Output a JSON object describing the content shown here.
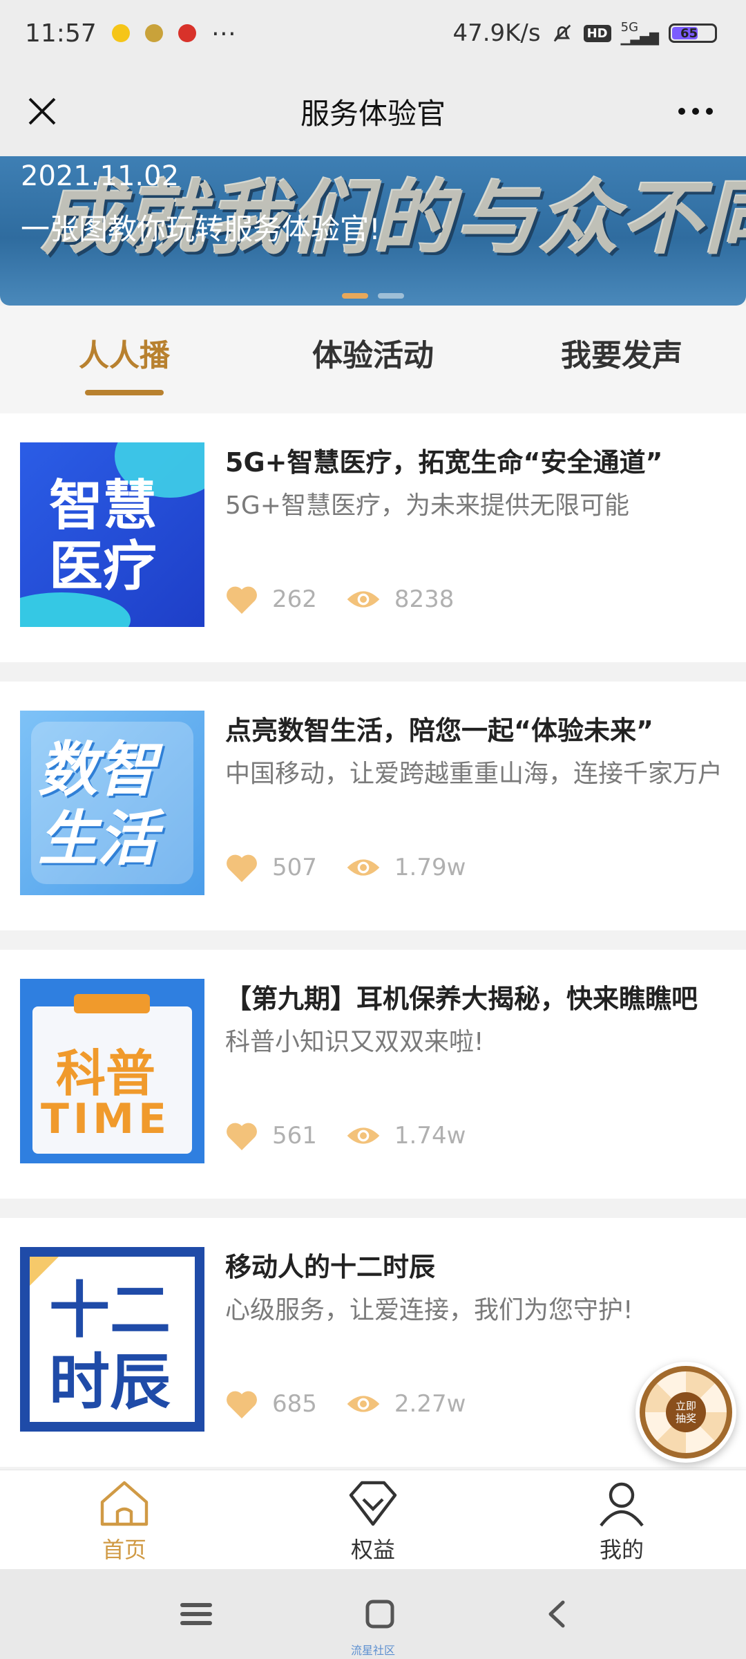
{
  "status_bar": {
    "time": "11:57",
    "more_icon": "⋯",
    "network_speed": "47.9K/s",
    "network_type": "5G",
    "hd_label": "HD",
    "battery": "65"
  },
  "title_bar": {
    "title": "服务体验官"
  },
  "banner": {
    "art_text": "成就我们的与众不同",
    "date": "2021.11.02",
    "caption": "一张图教你玩转服务体验官!"
  },
  "tabs": [
    {
      "label": "人人播",
      "active": true
    },
    {
      "label": "体验活动",
      "active": false
    },
    {
      "label": "我要发声",
      "active": false
    }
  ],
  "articles": [
    {
      "thumb_text": [
        "智慧",
        "医疗"
      ],
      "title": "5G+智慧医疗，拓宽生命“安全通道”",
      "desc": "5G+智慧医疗，为未来提供无限可能",
      "likes": "262",
      "views": "8238"
    },
    {
      "thumb_text": [
        "数智",
        "生活"
      ],
      "title": "点亮数智生活，陪您一起“体验未来”",
      "desc": "中国移动，让爱跨越重重山海，连接千家万户",
      "likes": "507",
      "views": "1.79w"
    },
    {
      "thumb_text": [
        "科普",
        "TIME"
      ],
      "title": "【第九期】耳机保养大揭秘，快来瞧瞧吧",
      "desc": "科普小知识又双双来啦!",
      "likes": "561",
      "views": "1.74w"
    },
    {
      "thumb_text": [
        "十二",
        "时辰"
      ],
      "title": "移动人的十二时辰",
      "desc": "心级服务，让爱连接，我们为您守护!",
      "likes": "685",
      "views": "2.27w"
    }
  ],
  "lottery": {
    "label_line1": "立即",
    "label_line2": "抽奖"
  },
  "bottom_nav": [
    {
      "label": "首页",
      "icon": "home-icon",
      "active": true
    },
    {
      "label": "权益",
      "icon": "diamond-icon",
      "active": false
    },
    {
      "label": "我的",
      "icon": "user-icon",
      "active": false
    }
  ],
  "system_nav": {
    "watermark": "流星社区"
  },
  "colors": {
    "accent": "#b8812f",
    "nav_active": "#d09a45",
    "like": "#f3c27a"
  }
}
